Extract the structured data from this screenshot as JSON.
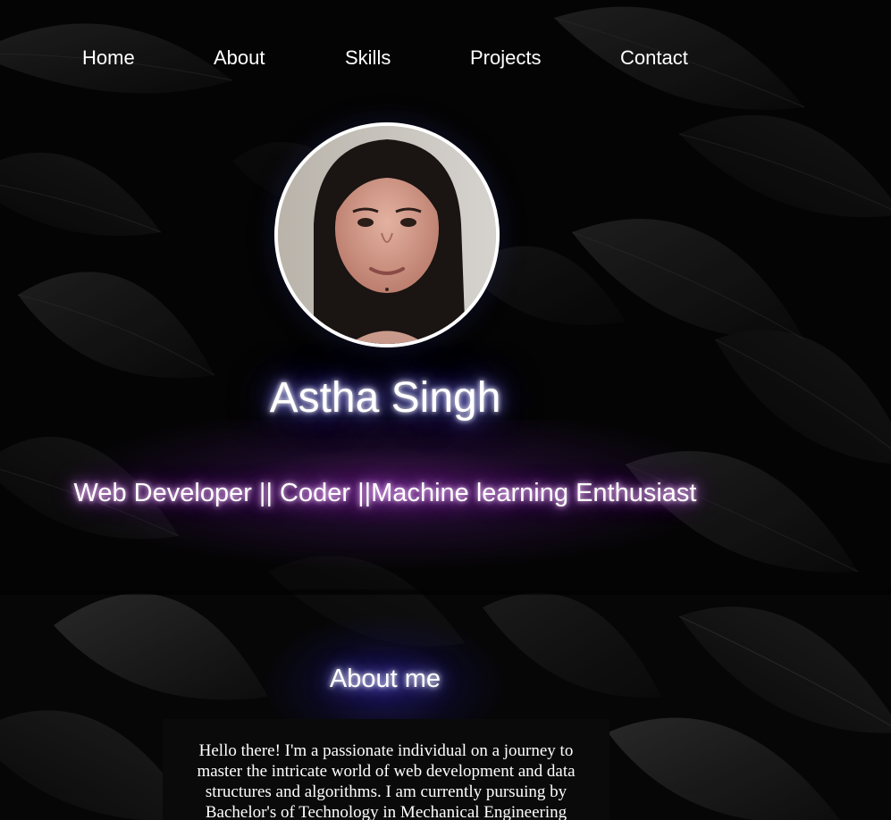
{
  "nav": {
    "items": [
      {
        "label": "Home"
      },
      {
        "label": "About"
      },
      {
        "label": "Skills"
      },
      {
        "label": "Projects"
      },
      {
        "label": "Contact"
      }
    ]
  },
  "hero": {
    "name": "Astha Singh",
    "tagline": "Web Developer || Coder ||Machine learning Enthusiast"
  },
  "about": {
    "title": "About me",
    "text": "Hello there! I'm a passionate individual on a journey to master the intricate world of web development and data structures and algorithms. I am currently pursuing by Bachelor's of Technology in Mechanical Engineering"
  },
  "colors": {
    "background": "#050505",
    "text": "#ffffff",
    "name_glow": "#5a4bd6",
    "tagline_glow": "#8a2fc0"
  }
}
